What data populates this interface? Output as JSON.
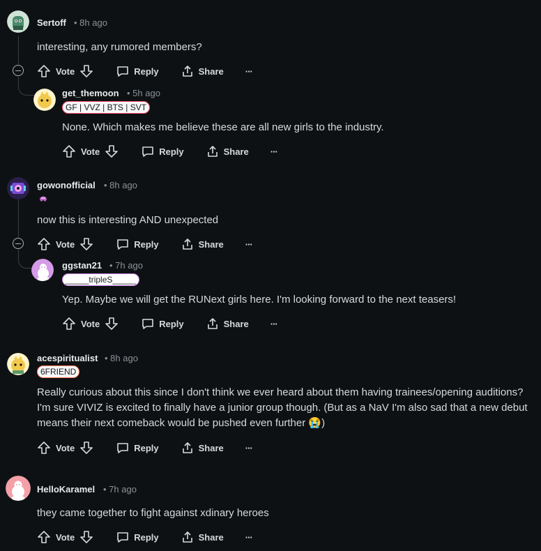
{
  "actions": {
    "vote": "Vote",
    "reply": "Reply",
    "share": "Share",
    "more": "···"
  },
  "comments": [
    {
      "user": "Sertoff",
      "time": "8h ago",
      "text": "interesting, any rumored members?",
      "avatar_color": "#4a8a6a"
    },
    {
      "user": "get_themoon",
      "time": "5h ago",
      "flair": "GF | VVZ | BTS | SVT",
      "text": "None. Which makes me believe these are all new girls to the industry.",
      "avatar_color": "#f2c94c"
    },
    {
      "user": "gowonofficial",
      "time": "8h ago",
      "text": "now this is interesting AND unexpected",
      "avatar_color": "#7b4bd6"
    },
    {
      "user": "ggstan21",
      "time": "7h ago",
      "flair": "_____tripleS_____",
      "text": "Yep. Maybe we will get the RUNext girls here. I'm looking forward to the next teasers!",
      "avatar_color": "#c77ee0"
    },
    {
      "user": "acespiritualist",
      "time": "8h ago",
      "flair": "6FRIEND",
      "text": "Really curious about this since I don't think we ever heard about them having trainees/opening auditions? I'm sure VIVIZ is excited to finally have a junior group though. (But as a NaV I'm also sad that a new debut means their next comeback would be pushed even further 😭)",
      "avatar_color": "#f2c94c"
    },
    {
      "user": "HelloKaramel",
      "time": "7h ago",
      "text": "they came together to fight against xdinary heroes",
      "avatar_color": "#f4a0a8"
    }
  ]
}
